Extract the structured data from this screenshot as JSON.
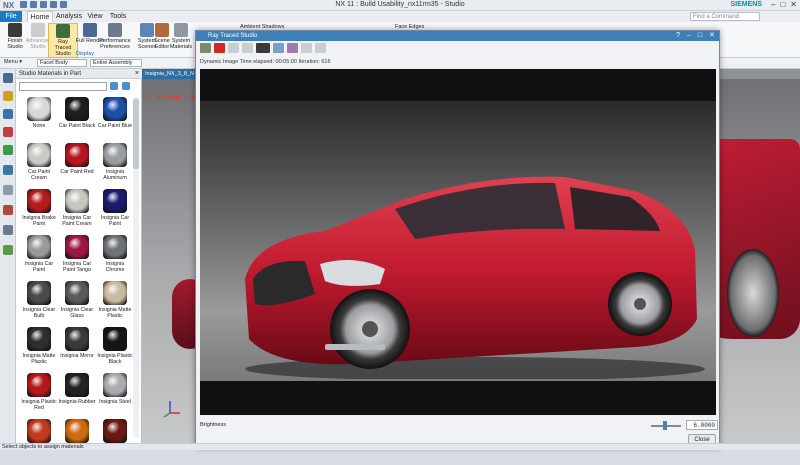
{
  "window": {
    "logo": "NX",
    "title": "NX 11 : Build Usability_nx11rm35 - Studio",
    "brand": "SIEMENS",
    "controls": [
      "–",
      "□",
      "✕"
    ]
  },
  "tabs": [
    "File",
    "Home",
    "Analysis",
    "View",
    "Tools"
  ],
  "search": {
    "placeholder": "Find a Command"
  },
  "ribbon": {
    "buttons": [
      "Finish Studio",
      "Advanced Studio",
      "Ray Traced Studio",
      "Full Render",
      "Performance Preferences",
      "System Scenes",
      "Scene Editor",
      "System Materials"
    ],
    "group_label": "Display",
    "extra": [
      "Ambient Shadows",
      "Face Edges"
    ]
  },
  "selection_bar": {
    "menu_label": "Menu ▾",
    "filter": "Facet Body",
    "scope": "Entire Assembly"
  },
  "palette": {
    "title": "Studio Materials in Part",
    "materials": [
      {
        "label": "None",
        "color": "#d8d8d8"
      },
      {
        "label": "Car Paint Black",
        "color": "#1f1f1f"
      },
      {
        "label": "Car Paint Blue",
        "color": "#1d4fa8"
      },
      {
        "label": "Car Paint Cream",
        "color": "#c9c9c6"
      },
      {
        "label": "Car Paint Red",
        "color": "#b5161f"
      },
      {
        "label": "Insignia Aluminum",
        "color": "#9a9ea3"
      },
      {
        "label": "Insignia Brake Paint",
        "color": "#b31c1c"
      },
      {
        "label": "Insignia Car Paint Cream",
        "color": "#c8c6c0"
      },
      {
        "label": "Insignia Car Paint",
        "color": "#1a1a6e"
      },
      {
        "label": "Insignia Car Paint",
        "color": "#9a9a9a"
      },
      {
        "label": "Insignia Car Paint Tango",
        "color": "#9c1745"
      },
      {
        "label": "Insignia Chrome",
        "color": "#6e7176"
      },
      {
        "label": "Insignia Clear Bulb",
        "color": "#4a4a4a"
      },
      {
        "label": "Insignia Clear Glass",
        "color": "#5a5a5a"
      },
      {
        "label": "Insignia Matte Plastic",
        "color": "#c9b9a0"
      },
      {
        "label": "Insignia Matte Plastic",
        "color": "#2e2e2e"
      },
      {
        "label": "Insignia Mirror",
        "color": "#3a3a3a"
      },
      {
        "label": "Insignia Plastic Black",
        "color": "#151515"
      },
      {
        "label": "Insignia Plastic Red",
        "color": "#b51818"
      },
      {
        "label": "Insignia Rubber",
        "color": "#222222"
      },
      {
        "label": "Insignia Steel",
        "color": "#a8abaf"
      },
      {
        "label": "",
        "color": "#c23a1a"
      },
      {
        "label": "",
        "color": "#d06a10"
      },
      {
        "label": "",
        "color": "#6a1a14"
      }
    ]
  },
  "graphics": {
    "tab_label": "Insignia_NX_3_8_N",
    "message": "In session parts"
  },
  "dialog": {
    "title": "Ray Traced Studio",
    "controls": [
      "?",
      "–",
      "□",
      "✕"
    ],
    "status": "Dynamic Image Time elapsed: 00:05:00  Iteration: 616",
    "brightness_label": "Brightness",
    "brightness_value": "6.0000",
    "close_label": "Close"
  },
  "status_bar": {
    "text": "Select objects to assign materials"
  }
}
